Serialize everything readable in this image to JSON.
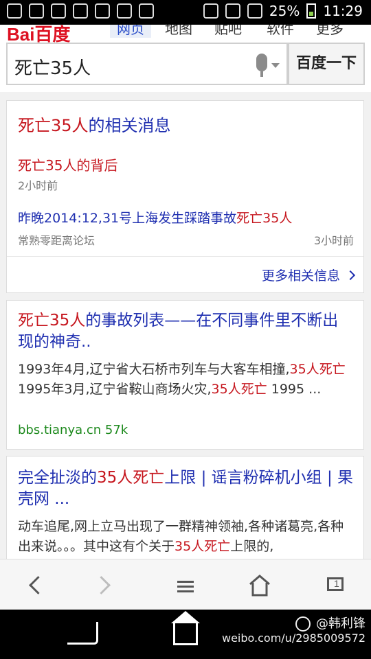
{
  "status_bar": {
    "battery_percent": "25%",
    "time": "11:29"
  },
  "top_nav": {
    "logo": "Bai百度",
    "tabs": [
      {
        "label": "网页",
        "active": true
      },
      {
        "label": "地图",
        "active": false
      },
      {
        "label": "贴吧",
        "active": false
      },
      {
        "label": "软件",
        "active": false
      },
      {
        "label": "更多",
        "active": false
      }
    ]
  },
  "search": {
    "query": "死亡35人",
    "button_label": "百度一下"
  },
  "card1": {
    "title_red": "死亡35人",
    "title_blue": "的相关消息",
    "item1_red": "死亡35人",
    "item1_blue": "的背后",
    "item1_time": "2小时前",
    "item2_blue": "昨晚2014:12,31号上海发生踩踏事故",
    "item2_red": "死亡35人",
    "item2_source": "常熟零距离论坛",
    "item2_time": "3小时前",
    "more_label": "更多相关信息"
  },
  "card2": {
    "title_red": "死亡35人",
    "title_blue": "的事故列表——在不同事件里不断出现的神奇..",
    "snippet_1": "1993年4月,辽宁省大石桥市列车与大客车相撞,",
    "snippet_red1": "35人死亡",
    "snippet_2": " 1995年3月,辽宁省鞍山商场火灾,",
    "snippet_red2": "35人死亡",
    "snippet_3": " 1995 ...",
    "url": "bbs.tianya.cn 57k"
  },
  "card3": {
    "title_blue1": "完全扯淡的",
    "title_red": "35人死亡",
    "title_blue2": "上限 | 谣言粉碎机小组 | 果壳网 ...",
    "snippet_1": "动车追尾,网上立马出现了一群精神领袖,各种诸葛亮,各种出来说。。。其中这有个关于",
    "snippet_red": "35人死亡",
    "snippet_2": "上限的,"
  },
  "browser_bar": {
    "back_icon": "chevron-left-icon",
    "forward_icon": "chevron-right-icon",
    "menu_icon": "menu-icon",
    "home_icon": "home-icon",
    "tabs_icon": "tabs-icon",
    "tabs_count": "1"
  },
  "watermark": {
    "handle": "@韩利锋",
    "url": "weibo.com/u/2985009572"
  }
}
